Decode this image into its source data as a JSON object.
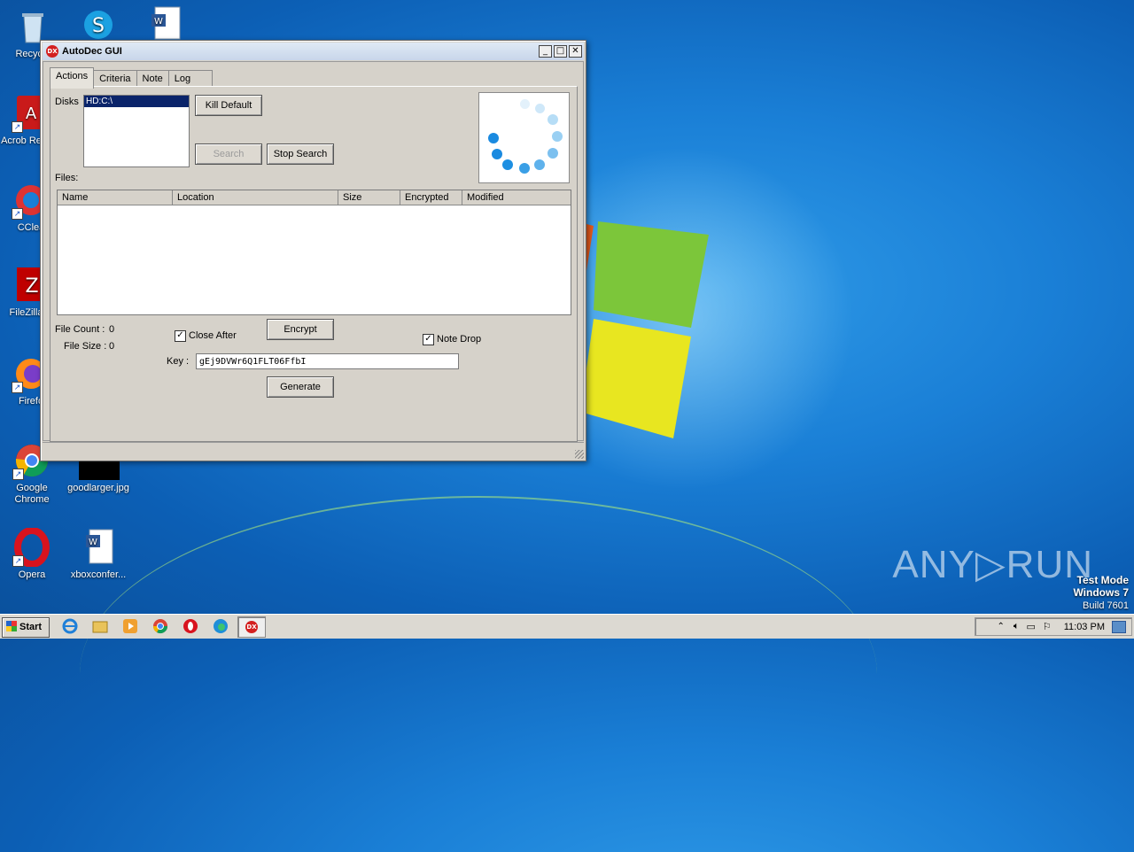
{
  "desktop": {
    "icons": [
      {
        "label": "Recycle"
      },
      {
        "label": ""
      },
      {
        "label": ""
      },
      {
        "label": "Acrob Reader"
      },
      {
        "label": "CClea"
      },
      {
        "label": "FileZilla C"
      },
      {
        "label": "Firefo"
      },
      {
        "label": "Google Chrome"
      },
      {
        "label": "goodlarger.jpg"
      },
      {
        "label": "Opera"
      },
      {
        "label": "xboxconfer..."
      }
    ]
  },
  "window": {
    "title": "AutoDec GUI",
    "icon_text": "DX",
    "controls": {
      "minimize": "_",
      "maximize": "□",
      "close": "✕"
    },
    "tabs": [
      "Actions",
      "Criteria",
      "Note",
      "Log"
    ],
    "active_tab": "Actions",
    "disks": {
      "label": "Disks",
      "items": [
        "HD:C:\\"
      ]
    },
    "buttons": {
      "kill_default": "Kill Default",
      "search": "Search",
      "stop_search": "Stop Search",
      "encrypt": "Encrypt",
      "generate": "Generate"
    },
    "files": {
      "label": "Files:",
      "columns": [
        "Name",
        "Location",
        "Size",
        "Encrypted",
        "Modified"
      ],
      "rows": []
    },
    "file_count": {
      "label": "File Count :",
      "value": "0"
    },
    "file_size": {
      "label": "File Size :",
      "value": "0"
    },
    "close_after": {
      "label": "Close After",
      "checked": true
    },
    "note_drop": {
      "label": "Note Drop",
      "checked": true
    },
    "key": {
      "label": "Key :",
      "value": "gEj9DVWr6Q1FLT06FfbI"
    }
  },
  "taskbar": {
    "start_label": "Start",
    "clock": "11:03 PM",
    "pinned": [
      "internet-explorer",
      "explorer",
      "media-player",
      "chrome",
      "opera",
      "edge",
      "autodec"
    ]
  },
  "watermark": {
    "brand": "ANY▷RUN",
    "line1": "Test Mode",
    "line2": "Windows 7",
    "line3": "Build 7601"
  },
  "colors": {
    "selection": "#0a246a",
    "window_bg": "#d6d2ca",
    "spinner": "#1a8ae0"
  }
}
